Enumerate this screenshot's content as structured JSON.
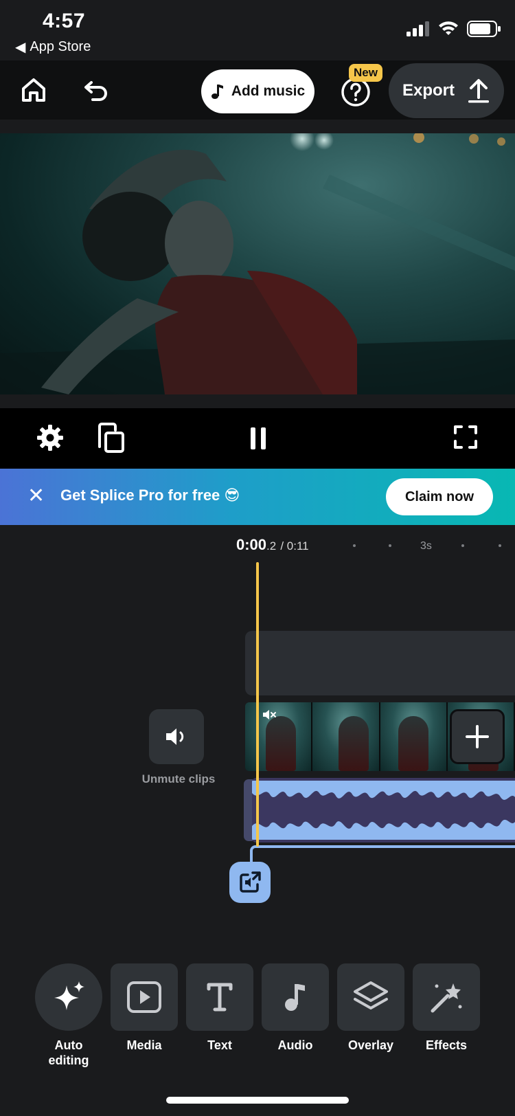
{
  "status": {
    "time": "4:57",
    "back_app": "App Store"
  },
  "toolbar": {
    "add_music_label": "Add music",
    "new_badge": "New",
    "export_label": "Export"
  },
  "promo": {
    "text": "Get Splice Pro for free 😎",
    "claim_label": "Claim now"
  },
  "timeline": {
    "timecode_main": "0:00",
    "timecode_fraction": ".2",
    "timecode_total": "/ 0:11",
    "ruler_mark": "3s",
    "unmute_label": "Unmute clips"
  },
  "tools": [
    {
      "label": "Auto editing",
      "icon": "sparkle-icon"
    },
    {
      "label": "Media",
      "icon": "media-play-icon"
    },
    {
      "label": "Text",
      "icon": "text-icon"
    },
    {
      "label": "Audio",
      "icon": "music-note-icon"
    },
    {
      "label": "Overlay",
      "icon": "layers-icon"
    },
    {
      "label": "Effects",
      "icon": "magic-wand-icon"
    }
  ],
  "colors": {
    "accent_yellow": "#f5c64a",
    "audio_blue": "#8fb8f0",
    "audio_track_bg": "#3b3760",
    "promo_gradient_start": "#4b73d6",
    "promo_gradient_end": "#08b8b3"
  }
}
